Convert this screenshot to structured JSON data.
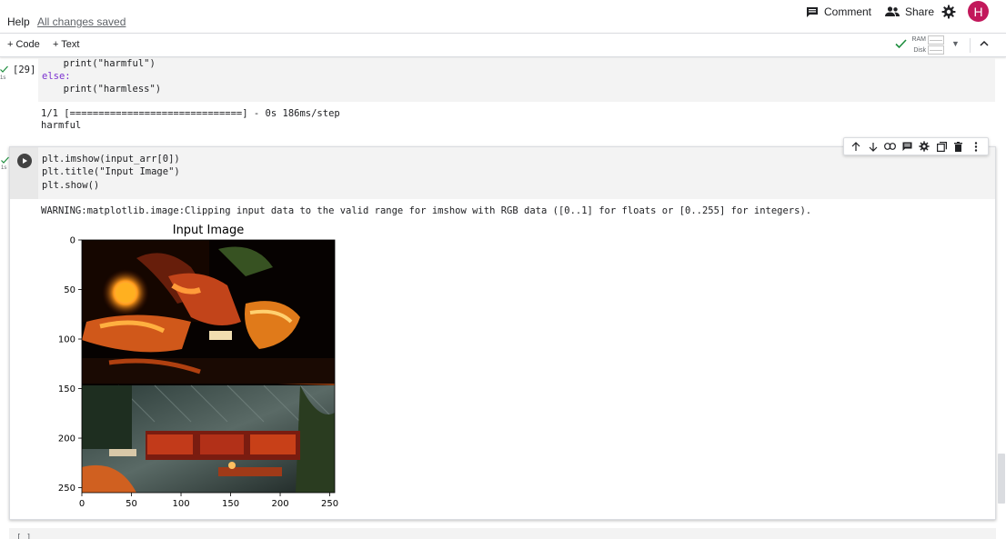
{
  "header": {
    "menu": [
      "Help"
    ],
    "save_status": "All changes saved",
    "comment_label": "Comment",
    "share_label": "Share",
    "avatar_letter": "H"
  },
  "toolbar": {
    "add_code_label": "+ Code",
    "add_text_label": "+ Text",
    "ram_label": "RAM",
    "disk_label": "Disk"
  },
  "cell1": {
    "exec_count": "[29]",
    "exec_time": "1s",
    "code_lines": [
      "  print(\"harmful\")",
      "else:",
      "  print(\"harmless\")"
    ],
    "output_lines": [
      "1/1 [==============================] - 0s 186ms/step",
      "harmful"
    ]
  },
  "cell2": {
    "exec_time": "1s",
    "code_lines": [
      "plt.imshow(input_arr[0])",
      "plt.title(\"Input Image\")",
      "plt.show()"
    ],
    "warning": "WARNING:matplotlib.image:Clipping input data to the valid range for imshow with RGB data ([0..1] for floats or [0..255] for integers)."
  },
  "chart_data": {
    "type": "image",
    "title": "Input Image",
    "xlabel": "",
    "ylabel": "",
    "xticks": [
      0,
      50,
      100,
      150,
      200,
      250
    ],
    "yticks": [
      0,
      50,
      100,
      150,
      200,
      250
    ],
    "xlim": [
      0,
      255
    ],
    "ylim": [
      255,
      0
    ],
    "grid": false
  },
  "cell3": {
    "exec_placeholder": "[ ]"
  }
}
